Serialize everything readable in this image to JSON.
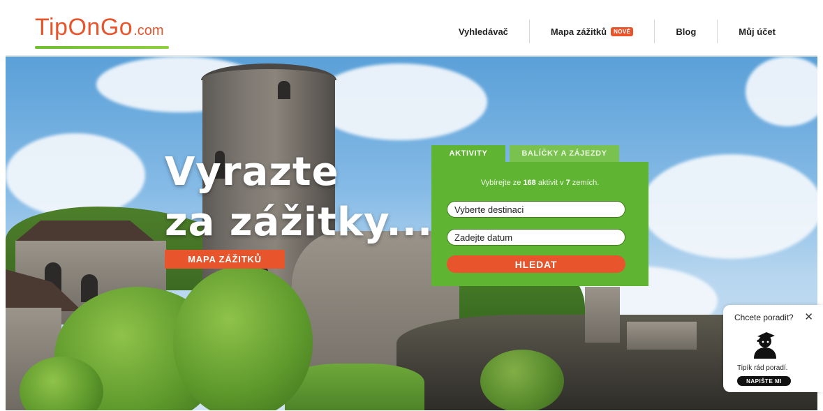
{
  "brand": {
    "logo_main": "TipOnGo",
    "logo_suffix": ".com"
  },
  "nav": {
    "items": [
      {
        "label": "Vyhledávač"
      },
      {
        "label": "Mapa zážitků",
        "badge": "NOVÉ"
      },
      {
        "label": "Blog"
      },
      {
        "label": "Můj účet"
      }
    ]
  },
  "hero": {
    "headline_line1": "Vyrazte",
    "headline_line2": "za zážitky...",
    "map_button": "MAPA ZÁŽITKŮ"
  },
  "search": {
    "tabs": [
      {
        "label": "AKTIVITY",
        "active": true
      },
      {
        "label": "BALÍČKY A ZÁJEZDY",
        "active": false
      }
    ],
    "info_prefix": "Vybírejte ze",
    "activity_count": "168",
    "info_middle": "aktivit v",
    "country_count": "7",
    "info_suffix": "zemích.",
    "destination_placeholder": "Vyberte destinaci",
    "date_placeholder": "Zadejte datum",
    "submit_label": "HLEDAT"
  },
  "chat": {
    "title": "Chcete poradit?",
    "close_icon": "close-icon",
    "text": "Tipík rád poradí.",
    "button": "NAPIŠTE MI"
  },
  "colors": {
    "brand_orange": "#e8542b",
    "brand_green": "#5fb431",
    "tab_inactive_green": "#7ac24f"
  }
}
